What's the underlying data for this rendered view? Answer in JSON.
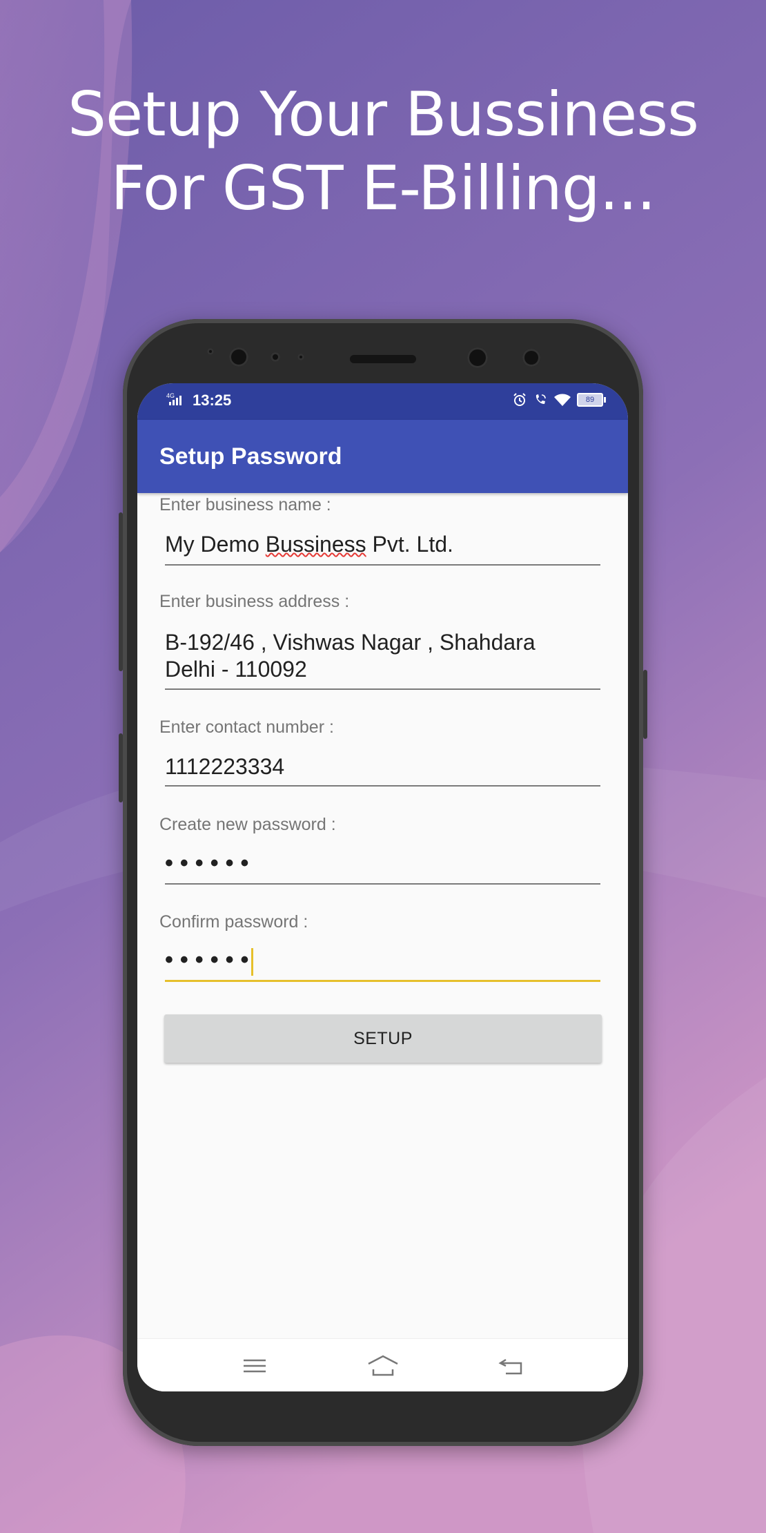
{
  "headline": {
    "line1": "Setup Your Bussiness",
    "line2": "For GST E-Billing..."
  },
  "status_bar": {
    "network": "4G",
    "time": "13:25",
    "icons": [
      "alarm-icon",
      "wifi-call-icon",
      "wifi-icon",
      "battery-icon"
    ],
    "battery": "89"
  },
  "app_bar": {
    "title": "Setup Password"
  },
  "form": {
    "business_name_label": "Enter business name :",
    "business_name_value_a": "My Demo ",
    "business_name_value_b": "Bussiness",
    "business_name_value_c": " Pvt. Ltd.",
    "business_address_label": "Enter business address :",
    "business_address_value": "B-192/46 , Vishwas Nagar , Shahdara\nDelhi - 110092",
    "contact_label": "Enter contact number :",
    "contact_value": "1112223334",
    "new_password_label": "Create new password :",
    "new_password_value": "••••••",
    "confirm_password_label": "Confirm password :",
    "confirm_password_value": "••••••",
    "setup_button": "SETUP"
  },
  "nav_bar": [
    "menu-icon",
    "home-icon",
    "back-icon"
  ],
  "colors": {
    "status_bar": "#2f3f9b",
    "app_bar": "#3f51b5",
    "focus_underline": "#e6c02b",
    "background_top": "#6b5aa8",
    "background_bottom": "#d49cc9"
  }
}
